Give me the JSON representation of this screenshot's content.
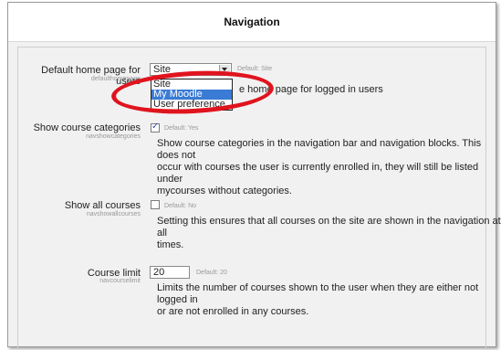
{
  "header": {
    "title": "Navigation"
  },
  "settings": {
    "home_page": {
      "label": "Default home page for users",
      "sublabel": "defaulthomepage",
      "selected": "Site",
      "default_note": "Default: Site",
      "desc_visible": "e home page for logged in users",
      "options": [
        "Site",
        "My Moodle",
        "User preference"
      ],
      "highlighted_option": "My Moodle"
    },
    "show_categories": {
      "label": "Show course categories",
      "sublabel": "navshowcategories",
      "checked": true,
      "default_note": "Default: Yes",
      "desc": [
        "Show course categories in the navigation bar and navigation blocks. This does not",
        "occur with courses the user is currently enrolled in, they will still be listed under",
        "mycourses without categories."
      ]
    },
    "show_all_courses": {
      "label": "Show all courses",
      "sublabel": "navshowallcourses",
      "checked": false,
      "default_note": "Default: No",
      "desc": [
        "Setting this ensures that all courses on the site are shown in the navigation at all",
        "times."
      ]
    },
    "course_limit": {
      "label": "Course limit",
      "sublabel": "navcourselimit",
      "value": "20",
      "default_note": "Default: 20",
      "desc": [
        "Limits the number of courses shown to the user when they are either not logged in",
        "or are not enrolled in any courses."
      ]
    }
  },
  "colors": {
    "highlight_ring": "#e0141e",
    "selected_option": "#3a7bd5"
  }
}
